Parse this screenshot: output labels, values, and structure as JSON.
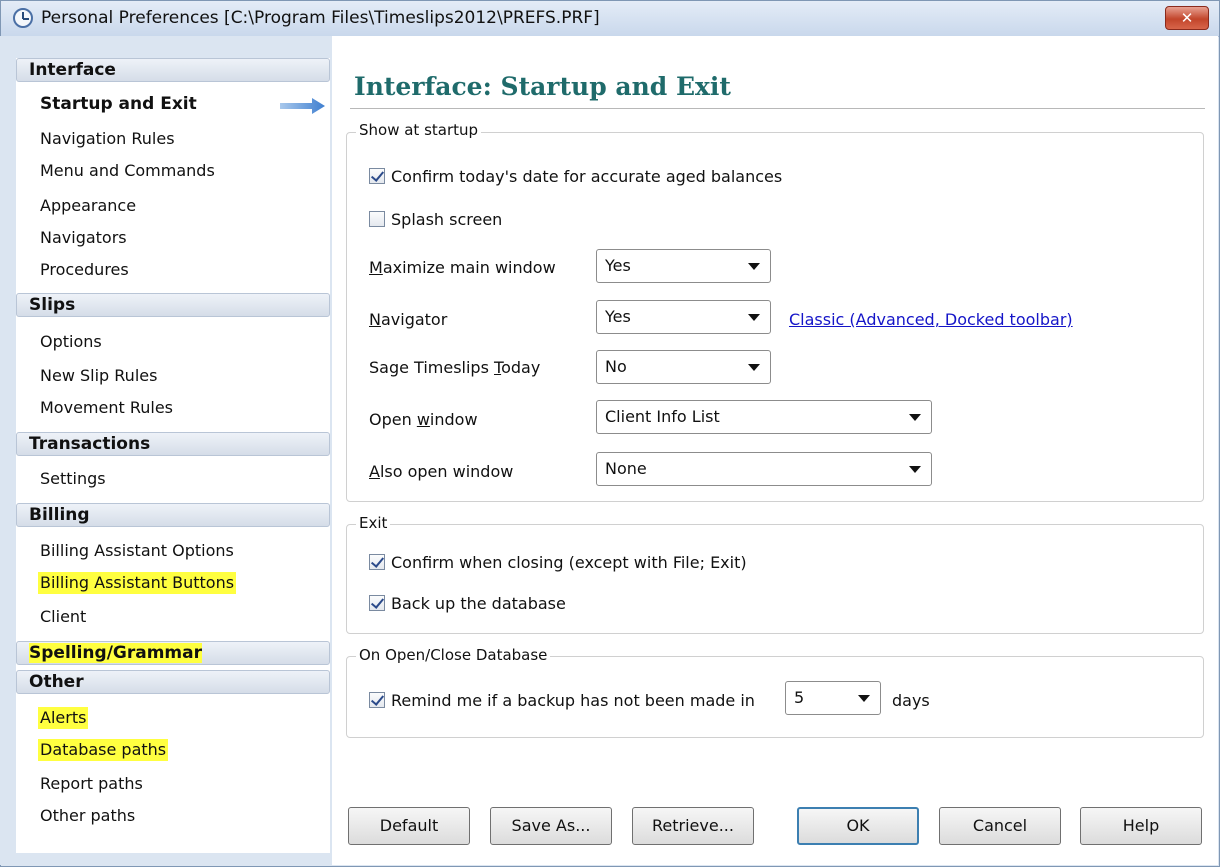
{
  "window": {
    "title": "Personal Preferences [C:\\Program Files\\Timeslips2012\\PREFS.PRF]",
    "close_label": "✕"
  },
  "sidebar": {
    "interface_header": "Interface",
    "interface_items": [
      "Startup and Exit",
      "Navigation Rules",
      "Menu and Commands",
      "Appearance",
      "Navigators",
      "Procedures"
    ],
    "slips_header": "Slips",
    "slips_items": [
      "Options",
      "New Slip Rules",
      "Movement Rules"
    ],
    "transactions_header": "Transactions",
    "transactions_items": [
      "Settings"
    ],
    "billing_header": "Billing",
    "billing_items": [
      "Billing Assistant Options",
      "Billing Assistant Buttons",
      "Client"
    ],
    "spelling_header": "Spelling/Grammar",
    "other_header": "Other",
    "other_items": [
      "Alerts",
      "Database paths",
      "Report paths",
      "Other paths"
    ],
    "active_item": "Startup and Exit"
  },
  "main": {
    "page_title": "Interface: Startup and Exit",
    "startup": {
      "label": "Show at startup",
      "confirm_date": {
        "label": "Confirm today's date for accurate aged balances",
        "checked": true
      },
      "splash": {
        "label": "Splash screen",
        "checked": false
      },
      "maximize": {
        "label_pre": "",
        "label_u": "M",
        "label_post": "aximize main window",
        "value": "Yes"
      },
      "navigator": {
        "label_pre": "",
        "label_u": "N",
        "label_post": "avigator",
        "value": "Yes",
        "link": "Classic (Advanced, Docked toolbar)"
      },
      "today": {
        "label_pre": "Sage Timeslips ",
        "label_u": "T",
        "label_post": "oday",
        "value": "No"
      },
      "open_window": {
        "label_pre": "Open ",
        "label_u": "w",
        "label_post": "indow",
        "value": "Client Info List"
      },
      "also_open": {
        "label_pre": "",
        "label_u": "A",
        "label_post": "lso open window",
        "value": "None"
      }
    },
    "exit": {
      "label": "Exit",
      "confirm_close": {
        "label": "Confirm when closing (except with File; Exit)",
        "checked": true
      },
      "backup": {
        "label": "Back up the database",
        "checked": true
      }
    },
    "open_close": {
      "label": "On Open/Close Database",
      "remind": {
        "label": "Remind me if a backup has not been made in",
        "value": "5",
        "suffix": "days",
        "checked": true
      }
    }
  },
  "buttons": {
    "default": "Default",
    "save_as": "Save As...",
    "retrieve": "Retrieve...",
    "ok": "OK",
    "cancel": "Cancel",
    "help": "Help"
  },
  "colors": {
    "title_accent": "#1f6b6b",
    "highlight": "#ffff40",
    "link": "#1515c8"
  }
}
